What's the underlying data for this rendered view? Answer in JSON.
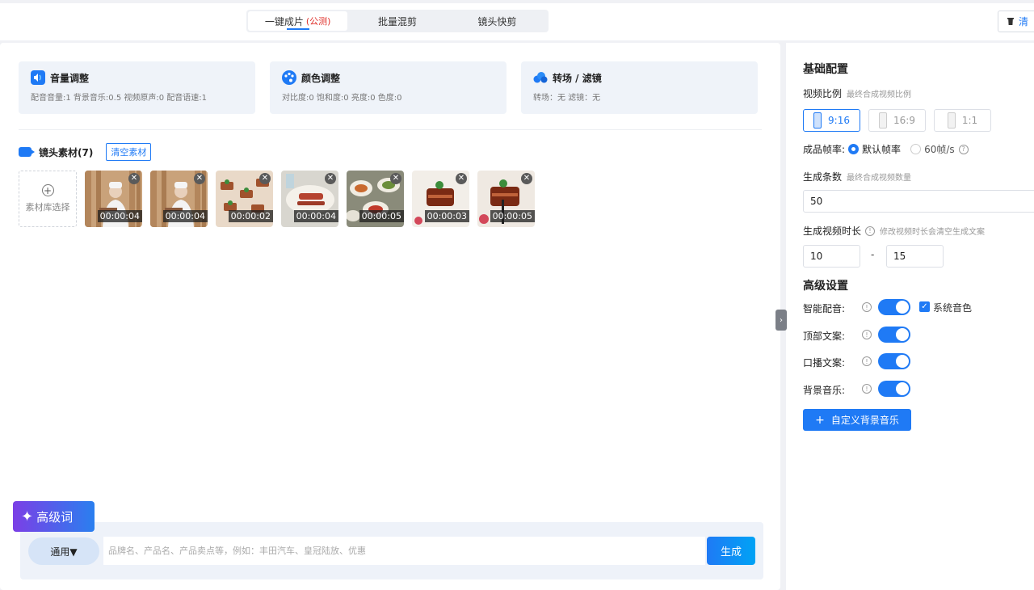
{
  "tabs": [
    {
      "label": "一键成片",
      "sub": "(公测)",
      "active": true
    },
    {
      "label": "批量混剪",
      "sub": "",
      "active": false
    },
    {
      "label": "镜头快剪",
      "sub": "",
      "active": false
    }
  ],
  "header": {
    "clear_label": "清"
  },
  "cards": [
    {
      "title": "音量调整",
      "icon": "volume-icon",
      "desc": "配音音量:1 背景音乐:0.5 视频原声:0 配音语速:1"
    },
    {
      "title": "颜色调整",
      "icon": "palette-icon",
      "desc": "对比度:0 饱和度:0 亮度:0 色度:0"
    },
    {
      "title": "转场 / 滤镜",
      "icon": "cloud-icon",
      "desc": "转场：无 滤镜：无"
    }
  ],
  "materials": {
    "title": "镜头素材(7)",
    "clear_label": "清空素材",
    "add_label": "素材库选择",
    "items": [
      {
        "duration": "00:00:04",
        "scene": "chef"
      },
      {
        "duration": "00:00:04",
        "scene": "chef"
      },
      {
        "duration": "00:00:02",
        "scene": "canapes"
      },
      {
        "duration": "00:00:04",
        "scene": "platter"
      },
      {
        "duration": "00:00:05",
        "scene": "table"
      },
      {
        "duration": "00:00:03",
        "scene": "pork"
      },
      {
        "duration": "00:00:05",
        "scene": "pork"
      }
    ]
  },
  "prompt": {
    "badge": "高级词",
    "mode": "通用▼",
    "placeholder": "品牌名、产品名、产品卖点等，例如：丰田汽车、皇冠陆放、优惠",
    "generate": "生成"
  },
  "settings": {
    "basic_title": "基础配置",
    "ratio_label": "视频比例",
    "ratio_hint": "最终合成视频比例",
    "ratios": [
      {
        "label": "9:16",
        "active": true
      },
      {
        "label": "16:9",
        "active": false
      },
      {
        "label": "1:1",
        "active": false
      }
    ],
    "fps_label": "成品帧率:",
    "fps_options": [
      {
        "label": "默认帧率",
        "selected": true
      },
      {
        "label": "60帧/s",
        "selected": false
      }
    ],
    "count_label": "生成条数",
    "count_hint": "最终合成视频数量",
    "count_value": "50",
    "duration_label": "生成视频时长",
    "duration_hint": "修改视频时长会清空生成文案",
    "duration_min": "10",
    "duration_sep": "-",
    "duration_max": "15",
    "advanced_title": "高级设置",
    "toggles": [
      {
        "label": "智能配音:",
        "on": true
      },
      {
        "label": "顶部文案:",
        "on": true
      },
      {
        "label": "口播文案:",
        "on": true
      },
      {
        "label": "背景音乐:",
        "on": true
      }
    ],
    "system_voice_label": "系统音色",
    "bgm_button": "自定义背景音乐"
  },
  "colors": {
    "accent": "#1f7af5",
    "danger": "#e0322c"
  }
}
